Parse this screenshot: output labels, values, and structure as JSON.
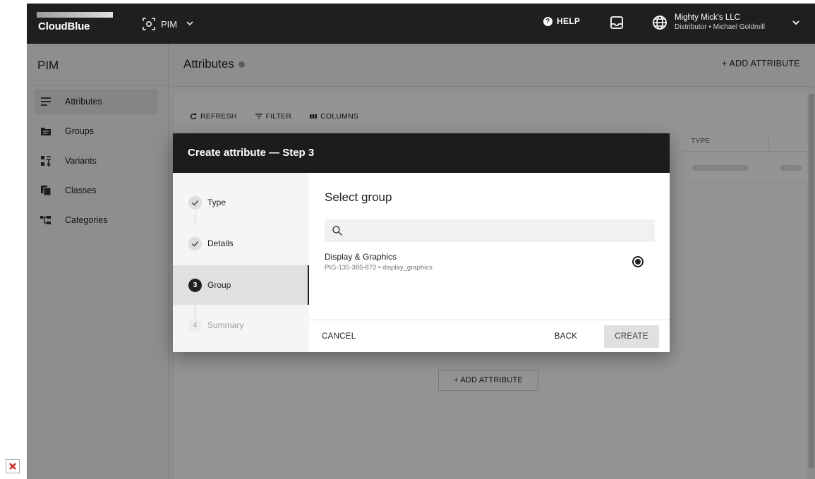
{
  "topbar": {
    "brand": "CloudBlue",
    "module": "PIM",
    "help": "HELP",
    "account_name": "Mighty Mick's LLC",
    "account_role": "Distributor • Michael Goldmill"
  },
  "sidebar": {
    "title": "PIM",
    "items": [
      {
        "label": "Attributes",
        "icon": "list-icon"
      },
      {
        "label": "Groups",
        "icon": "folder-icon"
      },
      {
        "label": "Variants",
        "icon": "variants-icon"
      },
      {
        "label": "Classes",
        "icon": "copy-icon"
      },
      {
        "label": "Categories",
        "icon": "tree-icon"
      }
    ]
  },
  "main": {
    "title": "Attributes",
    "add_label": "+ ADD ATTRIBUTE",
    "toolbar": {
      "refresh": "REFRESH",
      "filter": "FILTER",
      "columns": "COLUMNS"
    },
    "column_type": "TYPE",
    "bottom_add": "+ ADD ATTRIBUTE"
  },
  "dialog": {
    "title": "Create attribute — Step 3",
    "steps": [
      {
        "label": "Type",
        "state": "done"
      },
      {
        "label": "Details",
        "state": "done"
      },
      {
        "number": "3",
        "label": "Group",
        "state": "active"
      },
      {
        "number": "4",
        "label": "Summary",
        "state": "todo"
      }
    ],
    "section_title": "Select group",
    "search_placeholder": "",
    "group": {
      "name": "Display & Graphics",
      "meta": "PIG-135-385-872 • display_graphics",
      "selected": true
    },
    "buttons": {
      "cancel": "CANCEL",
      "back": "BACK",
      "create": "CREATE"
    }
  },
  "colors": {
    "topbar": "#1f1f1f",
    "dialog_header": "#1c1c1c",
    "accent": "#212121"
  }
}
